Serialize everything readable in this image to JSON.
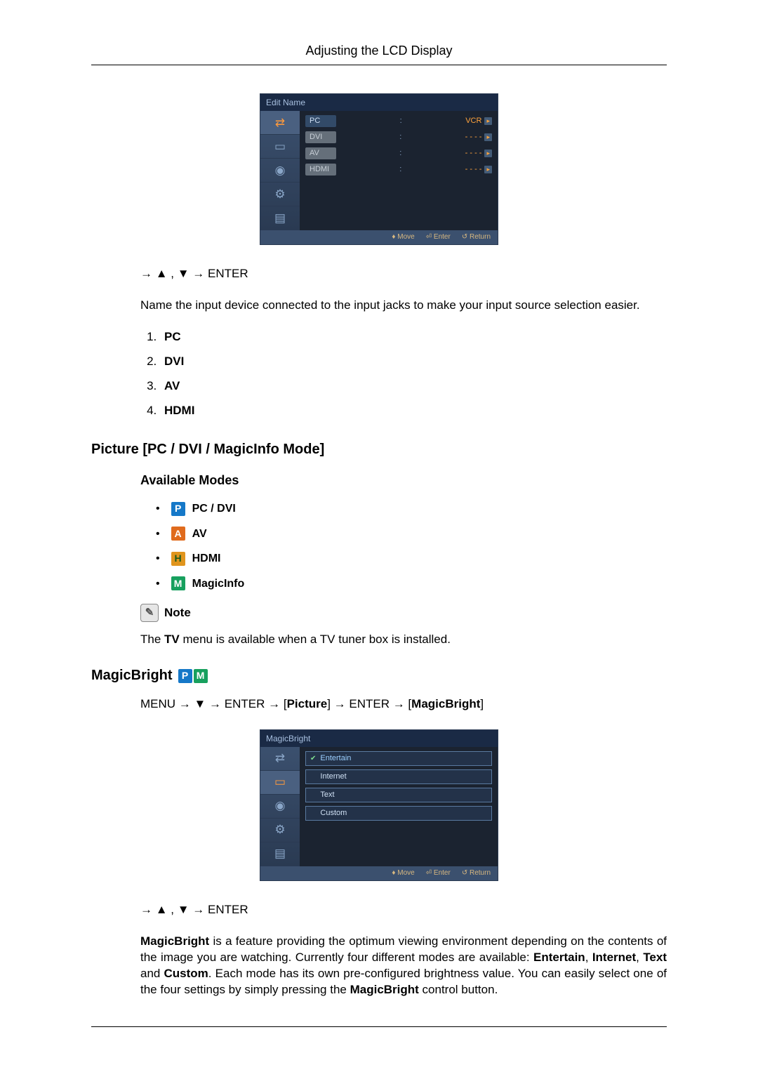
{
  "header_title": "Adjusting the LCD Display",
  "osd1": {
    "title": "Edit Name",
    "rows": [
      {
        "label": "PC",
        "value": "VCR",
        "grey": false
      },
      {
        "label": "DVI",
        "value": "- - - -",
        "grey": true
      },
      {
        "label": "AV",
        "value": "- - - -",
        "grey": true
      },
      {
        "label": "HDMI",
        "value": "- - - -",
        "grey": true
      }
    ],
    "footer": {
      "move": "Move",
      "enter": "Enter",
      "return": "Return"
    }
  },
  "nav1": "→ ▲ , ▼ → ENTER",
  "desc1": "Name the input device connected to the input jacks to make your input source selection easier.",
  "input_list": [
    "PC",
    "DVI",
    "AV",
    "HDMI"
  ],
  "section_picture_title": "Picture [PC / DVI / MagicInfo Mode]",
  "available_modes_title": "Available Modes",
  "modes": [
    {
      "icon": "P",
      "cls": "p",
      "label": "PC / DVI"
    },
    {
      "icon": "A",
      "cls": "a",
      "label": "AV"
    },
    {
      "icon": "H",
      "cls": "h",
      "label": "HDMI"
    },
    {
      "icon": "M",
      "cls": "m",
      "label": "MagicInfo"
    }
  ],
  "note_label": "Note",
  "note_text_pre": "The ",
  "note_text_bold": "TV",
  "note_text_post": " menu is available when a TV tuner box is installed.",
  "magic_heading": "MagicBright",
  "magic_nav_pre": "MENU → ▼ → ENTER → [",
  "magic_nav_b1": "Picture",
  "magic_nav_mid": "] → ENTER → [",
  "magic_nav_b2": "MagicBright",
  "magic_nav_post": "]",
  "osd2": {
    "title": "MagicBright",
    "options": [
      "Entertain",
      "Internet",
      "Text",
      "Custom"
    ],
    "footer": {
      "move": "Move",
      "enter": "Enter",
      "return": "Return"
    }
  },
  "nav2": "→ ▲ , ▼ → ENTER",
  "magic_desc_b1": "MagicBright",
  "magic_desc_1": " is a feature providing the optimum viewing environment depending on the contents of the image you are watching. Currently four different modes are available: ",
  "magic_desc_b2": "Entertain",
  "magic_desc_2": ", ",
  "magic_desc_b3": "Internet",
  "magic_desc_3": ", ",
  "magic_desc_b4": "Text",
  "magic_desc_4": " and ",
  "magic_desc_b5": "Custom",
  "magic_desc_5": ". Each mode has its own pre-configured brightness value. You can easily select one of the four settings by simply pressing the ",
  "magic_desc_b6": "MagicBright",
  "magic_desc_6": " control button."
}
